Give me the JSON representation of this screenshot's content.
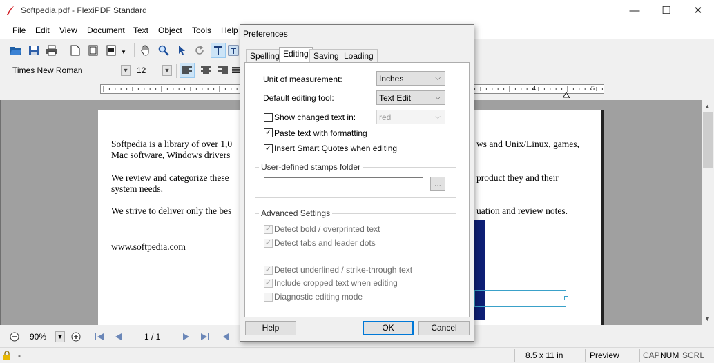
{
  "window": {
    "title": "Softpedia.pdf - FlexiPDF Standard",
    "controls": {
      "minimize": "—",
      "maximize": "☐",
      "close": "✕"
    }
  },
  "menu": [
    "File",
    "Edit",
    "View",
    "Document",
    "Text",
    "Object",
    "Tools",
    "Help"
  ],
  "format_bar": {
    "font": "Times New Roman",
    "size": "12"
  },
  "ruler": {
    "labels": [
      "4",
      "5"
    ]
  },
  "document": {
    "lines": [
      "Softpedia is a library of over 1,0",
      "Mac software, Windows drivers",
      "We review and categorize these",
      "system needs.",
      "We strive to deliver only the bes",
      "www.softpedia.com"
    ],
    "right_lines": [
      "ws and Unix/Linux, games,",
      "product they and their",
      "uation and review notes."
    ]
  },
  "navigation": {
    "zoom": "90%",
    "page": "1 / 1"
  },
  "status": {
    "page_size": "8.5 x 11 in",
    "mode": "Preview",
    "cap": "CAP",
    "num": "NUM",
    "scrl": "SCRL",
    "left_dash": "-"
  },
  "dialog": {
    "title": "Preferences",
    "tabs": [
      "Spelling",
      "Editing",
      "Saving",
      "Loading"
    ],
    "selected_tab": "Editing",
    "unit_label": "Unit of measurement:",
    "unit_value": "Inches",
    "tool_label": "Default editing tool:",
    "tool_value": "Text Edit",
    "show_changed_label": "Show changed text in:",
    "show_changed_color": "red",
    "paste_label": "Paste text with formatting",
    "smart_quotes_label": "Insert Smart Quotes when editing",
    "stamps_group": "User-defined stamps folder",
    "stamps_path": "",
    "browse_label": "...",
    "advanced_group": "Advanced Settings",
    "adv": [
      "Detect bold / overprinted text",
      "Detect tabs and leader dots",
      "Detect underlined / strike-through text",
      "Include cropped text when editing",
      "Diagnostic editing mode"
    ],
    "help_label": "Help",
    "ok_label": "OK",
    "cancel_label": "Cancel"
  },
  "colors": {
    "accent": "#0078d7",
    "doc_background": "#a0a0a0",
    "blue_block": "#0d1f75"
  }
}
